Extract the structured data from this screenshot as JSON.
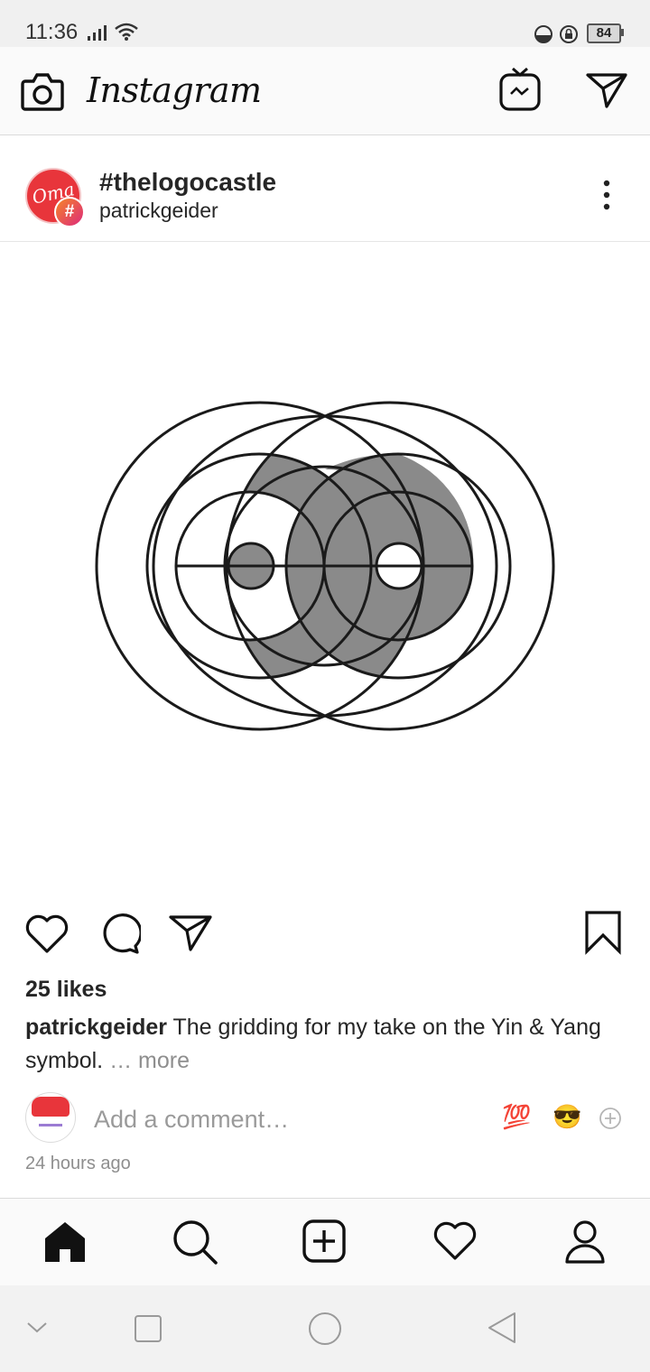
{
  "status_bar": {
    "time": "11:36",
    "battery": "84"
  },
  "app_header": {
    "logo_text": "Instagram",
    "icons": [
      "camera-icon",
      "igtv-icon",
      "direct-message-icon"
    ]
  },
  "post": {
    "hashtag": "#thelogocastle",
    "username": "patrickgeider",
    "avatar_text": "Oma",
    "avatar_badge": "#",
    "image_description_icon": "yin-yang-grid-drawing",
    "likes": "25 likes",
    "caption_user": "patrickgeider",
    "caption_text": " The gridding for my take on the Yin & Yang symbol.",
    "caption_more": " … more",
    "comment_placeholder": "Add a comment…",
    "quick_emoji_100": "💯",
    "quick_emoji_cool": "😎",
    "time_ago": "24 hours ago"
  },
  "bottom_nav": [
    "home-icon",
    "search-icon",
    "new-post-icon",
    "activity-heart-icon",
    "profile-icon"
  ],
  "colors": {
    "accent_red": "#e8353b",
    "fill_gray": "#8a8a8a",
    "muted_text": "#8e8e8e"
  }
}
